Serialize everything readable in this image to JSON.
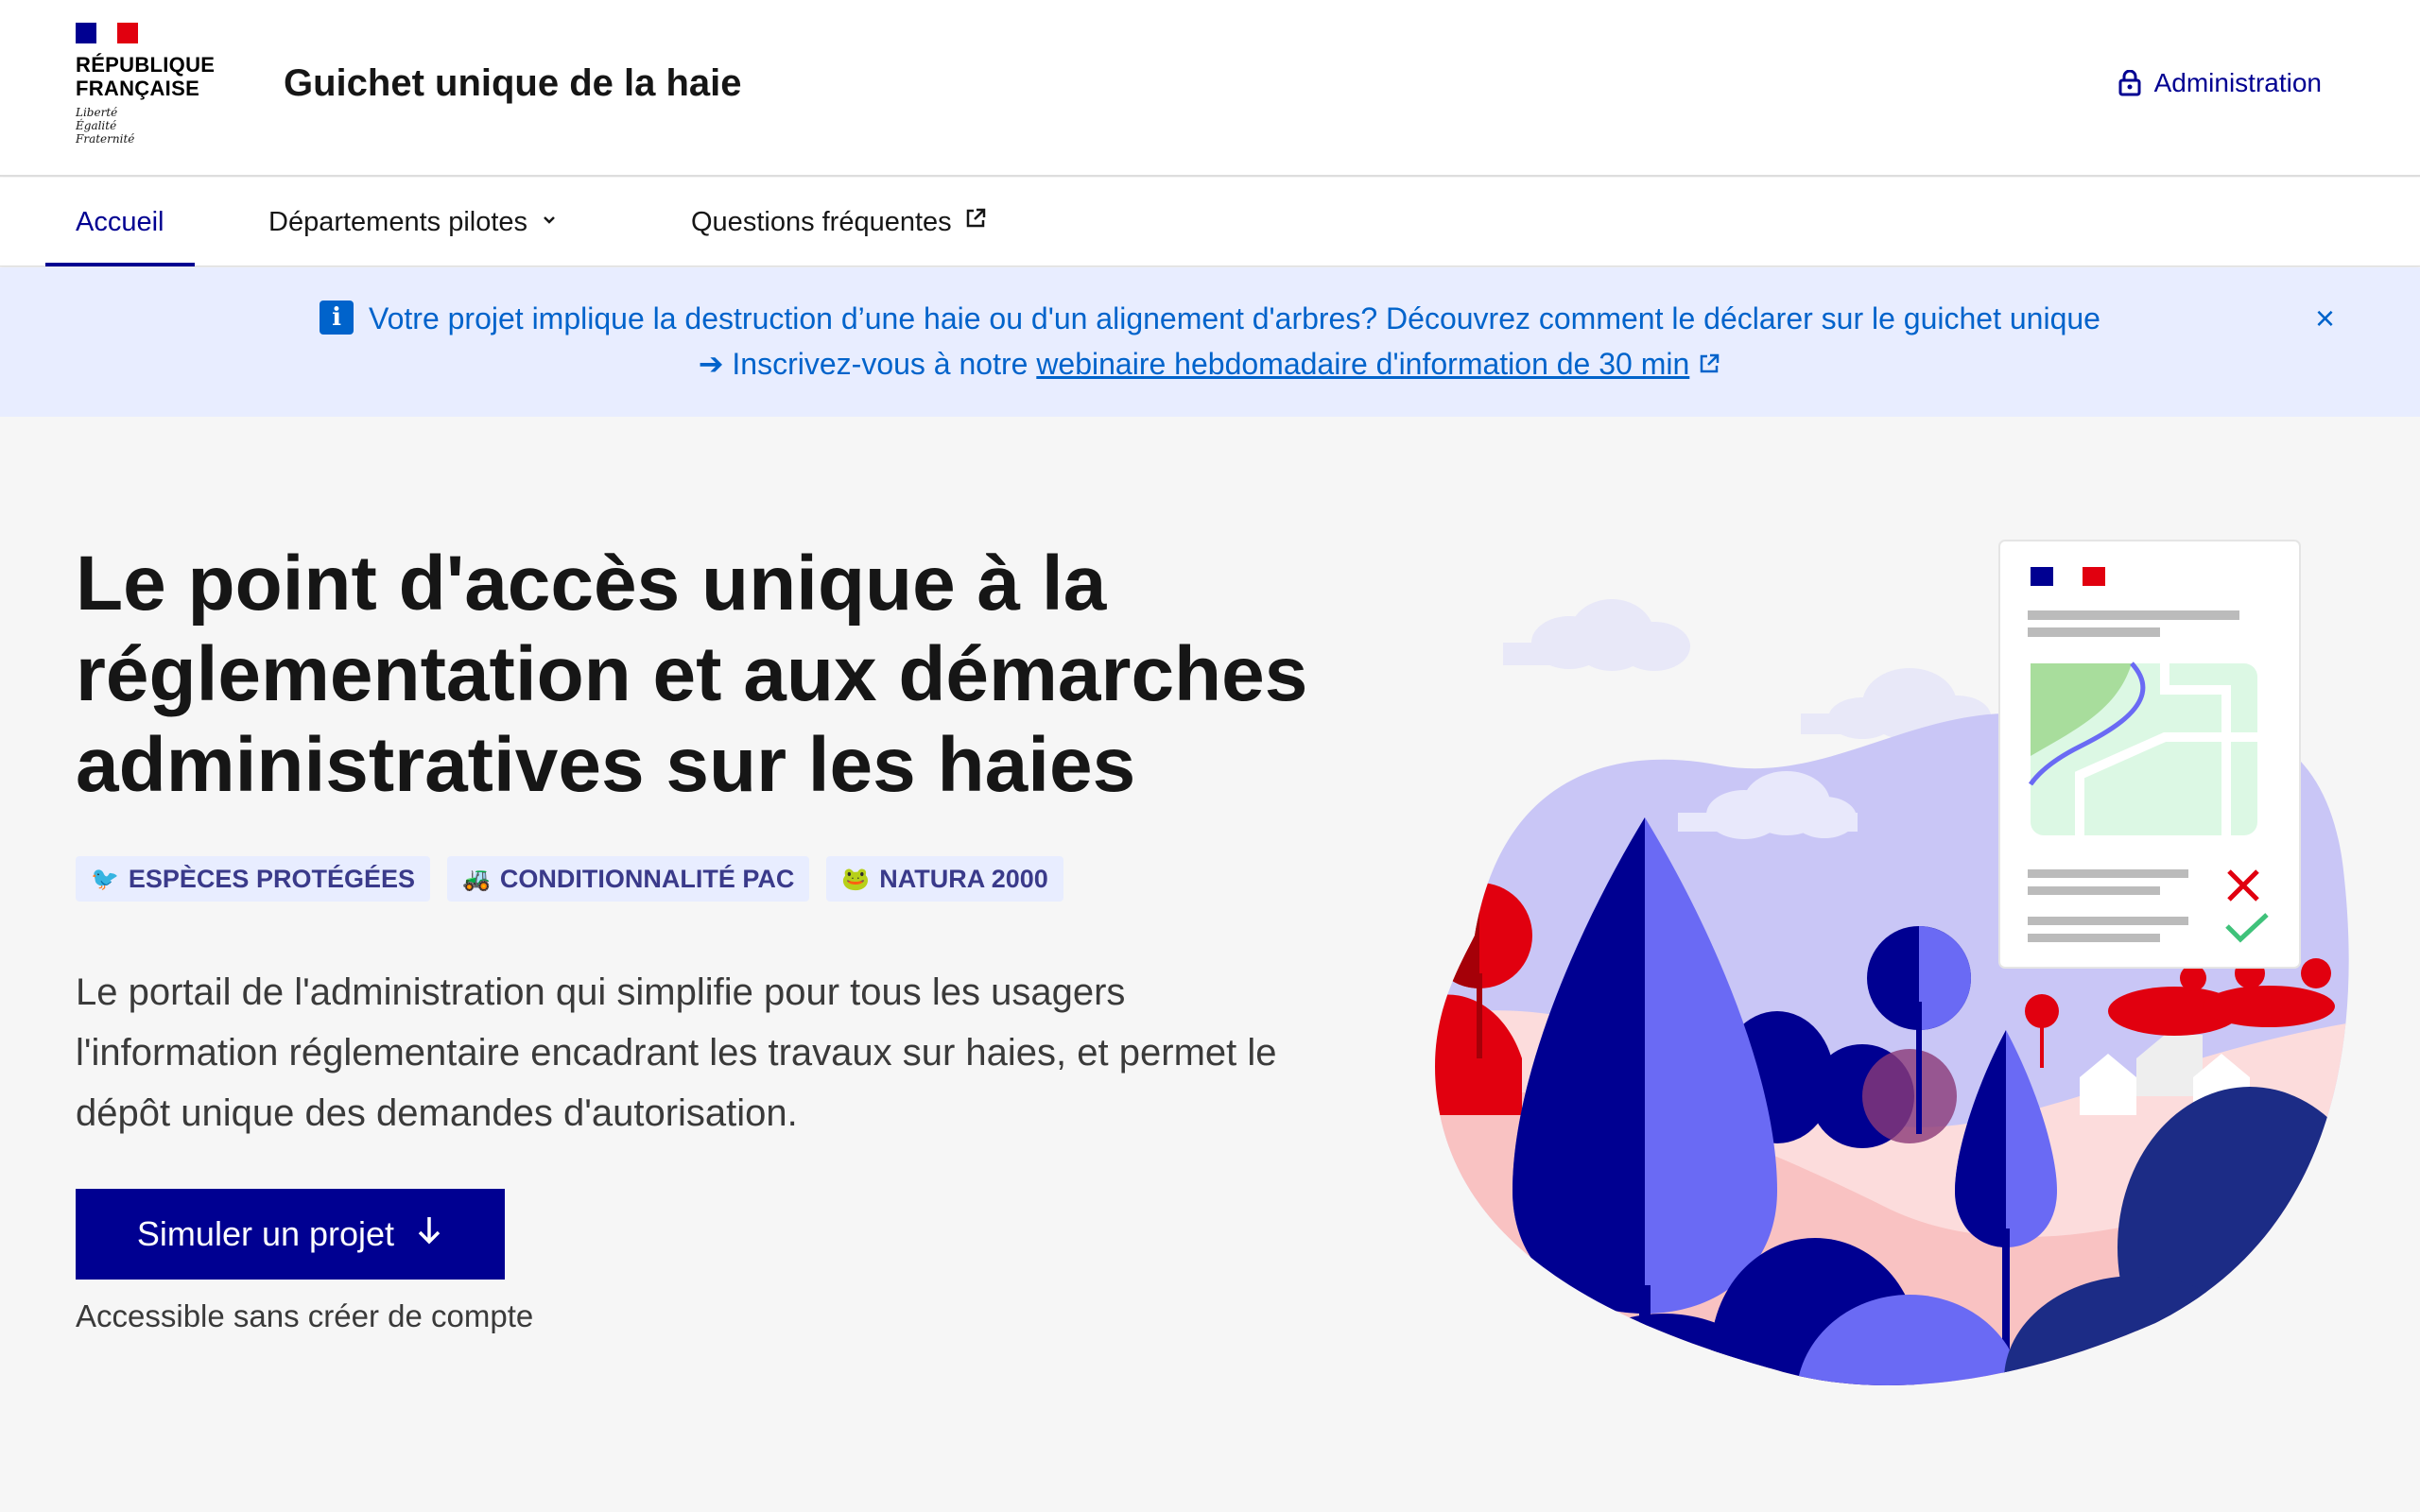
{
  "header": {
    "logo_text": "RÉPUBLIQUE\nFRANÇAISE",
    "motto": [
      "Liberté",
      "Égalité",
      "Fraternité"
    ],
    "site_title": "Guichet unique de la haie",
    "admin_label": "Administration"
  },
  "nav": {
    "items": [
      {
        "label": "Accueil",
        "active": true
      },
      {
        "label": "Départements pilotes",
        "has_dropdown": true
      },
      {
        "label": "Questions fréquentes",
        "external": true
      }
    ]
  },
  "notice": {
    "line1": "Votre projet implique la destruction d’une haie ou d'un alignement d'arbres? Découvrez comment le déclarer sur le guichet unique",
    "line2_prefix": "➔ Inscrivez-vous à notre ",
    "line2_link": "webinaire hebdomadaire d'information de 30 min",
    "close_label": "×"
  },
  "hero": {
    "title": "Le point d'accès unique à la réglementation et aux démarches administratives sur les haies",
    "tags": [
      {
        "icon": "🐦",
        "label": "ESPÈCES PROTÉGÉES"
      },
      {
        "icon": "🚜",
        "label": "CONDITIONNALITÉ PAC"
      },
      {
        "icon": "🐸",
        "label": "NATURA 2000"
      }
    ],
    "description": "Le portail de l'administration qui simplifie pour tous les usagers l'information réglementaire encadrant les travaux sur haies, et permet le dépôt unique des demandes d'autorisation.",
    "cta_label": "Simuler un projet",
    "cta_sub": "Accessible sans créer de compte"
  },
  "colors": {
    "primary": "#000091",
    "notice_bg": "#e8edff",
    "notice_text": "#0063cb",
    "marianne_red": "#e1000f"
  }
}
